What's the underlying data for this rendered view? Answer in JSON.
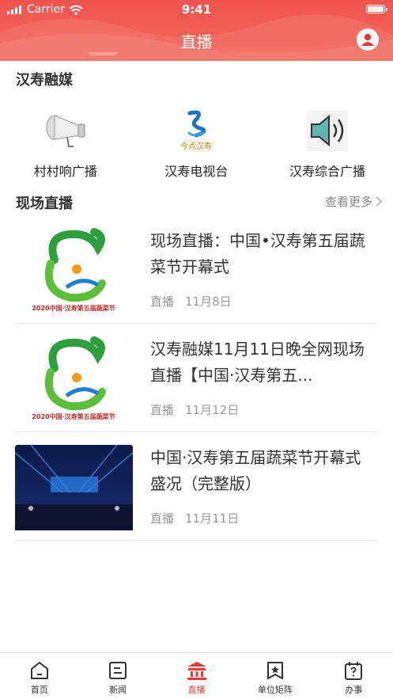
{
  "status_bar": {
    "carrier": "Carrier",
    "time": "9:41"
  },
  "header": {
    "title": "直播"
  },
  "section1": {
    "title": "汉寿融媒",
    "items": [
      {
        "label": "村村响广播",
        "icon": "loudspeaker-icon"
      },
      {
        "label": "汉寿电视台",
        "icon": "tv-station-logo"
      },
      {
        "label": "汉寿综合广播",
        "icon": "speaker-icon"
      }
    ]
  },
  "section2": {
    "title": "现场直播",
    "more_label": "查看更多",
    "items": [
      {
        "title": "现场直播：中国•汉寿第五届蔬菜节开幕式",
        "tag": "直播",
        "date": "11月8日",
        "thumb": "festival-logo"
      },
      {
        "title": "汉寿融媒11月11日晚全网现场直播【中国·汉寿第五...",
        "tag": "直播",
        "date": "11月12日",
        "thumb": "festival-logo"
      },
      {
        "title": "中国·汉寿第五届蔬菜节开幕式盛况（完整版）",
        "tag": "直播",
        "date": "11月11日",
        "thumb": "stage-photo"
      }
    ]
  },
  "thumb_caption": "2020中国·汉寿第五届蔬菜节",
  "tv_logo_text": "今点汉寿",
  "tabbar": {
    "active_color": "#e53935",
    "items": [
      {
        "label": "首页",
        "icon": "home-icon"
      },
      {
        "label": "新闻",
        "icon": "news-icon"
      },
      {
        "label": "直播",
        "icon": "live-icon",
        "active": true
      },
      {
        "label": "单位矩阵",
        "icon": "star-badge-icon"
      },
      {
        "label": "办事",
        "icon": "calendar-help-icon"
      }
    ]
  }
}
